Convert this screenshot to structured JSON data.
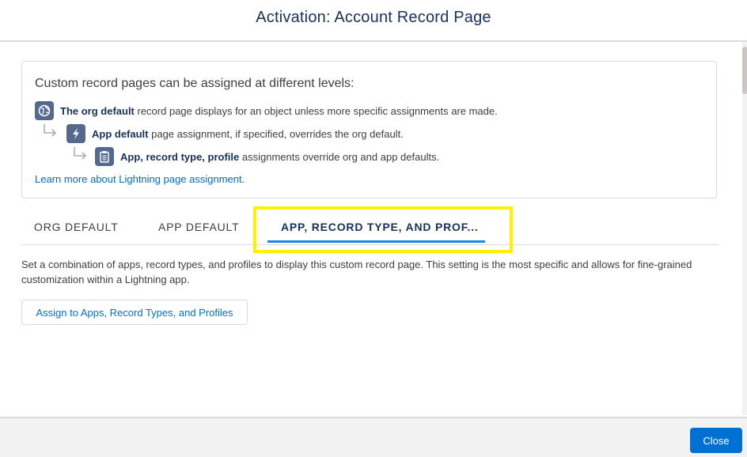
{
  "modal": {
    "title": "Activation: Account Record Page"
  },
  "info": {
    "heading": "Custom record pages can be assigned at different levels:",
    "levels": [
      {
        "icon": "globe-icon",
        "bold": "The org default",
        "text": " record page displays for an object unless more specific assignments are made."
      },
      {
        "icon": "lightning-bolt-icon",
        "bold": "App default",
        "text": " page assignment, if specified, overrides the org default."
      },
      {
        "icon": "clipboard-icon",
        "bold": "App, record type, profile",
        "text": " assignments override org and app defaults."
      }
    ],
    "learn_more_link": "Learn more about Lightning page assignment."
  },
  "tabs": [
    {
      "label": "ORG DEFAULT",
      "active": false
    },
    {
      "label": "APP DEFAULT",
      "active": false
    },
    {
      "label": "APP, RECORD TYPE, AND PROF...",
      "active": true
    }
  ],
  "active_tab": {
    "description": "Set a combination of apps, record types, and profiles to display this custom record page. This setting is the most specific and allows for fine-grained customization within a Lightning app.",
    "assign_button": "Assign to Apps, Record Types, and Profiles"
  },
  "footer": {
    "close_button": "Close"
  },
  "colors": {
    "accent": "#0070d2",
    "tab_indicator": "#1589ee",
    "highlight": "#fef200",
    "icon_bg": "#54698d",
    "title": "#16325c"
  }
}
